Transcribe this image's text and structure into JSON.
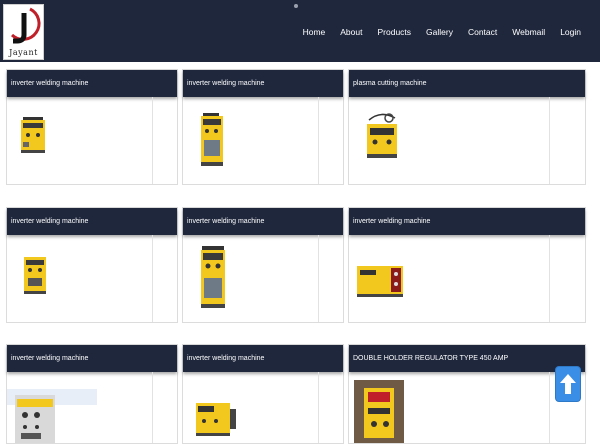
{
  "brand": {
    "logo_text": "Jayant"
  },
  "nav": {
    "items": [
      "Home",
      "About",
      "Products",
      "Gallery",
      "Contact",
      "Webmail",
      "Login"
    ]
  },
  "products": [
    {
      "title": "inverter welding machine",
      "image": "yellow-inverter-welder-1"
    },
    {
      "title": "inverter welding machine",
      "image": "yellow-inverter-welder-tall-1"
    },
    {
      "title": "plasma cutting machine",
      "image": "plasma-cutter"
    },
    {
      "title": "inverter welding machine",
      "image": "yellow-inverter-welder-2"
    },
    {
      "title": "inverter welding machine",
      "image": "yellow-inverter-welder-tall-2"
    },
    {
      "title": "inverter welding machine",
      "image": "yellow-inverter-welder-3"
    },
    {
      "title": "inverter welding machine",
      "image": "tig-welder"
    },
    {
      "title": "inverter welding machine",
      "image": "yellow-inverter-welder-4"
    },
    {
      "title": "DOUBLE HOLDER REGULATOR TYPE 450 AMP",
      "image": "double-holder-regulator"
    }
  ],
  "colors": {
    "navbar": "#1f273d",
    "card_header": "#1f273d",
    "machine_yellow": "#f2c81e",
    "scroll_button": "#3a8ee6"
  },
  "icons": {
    "scroll_top": "arrow-up-icon"
  }
}
